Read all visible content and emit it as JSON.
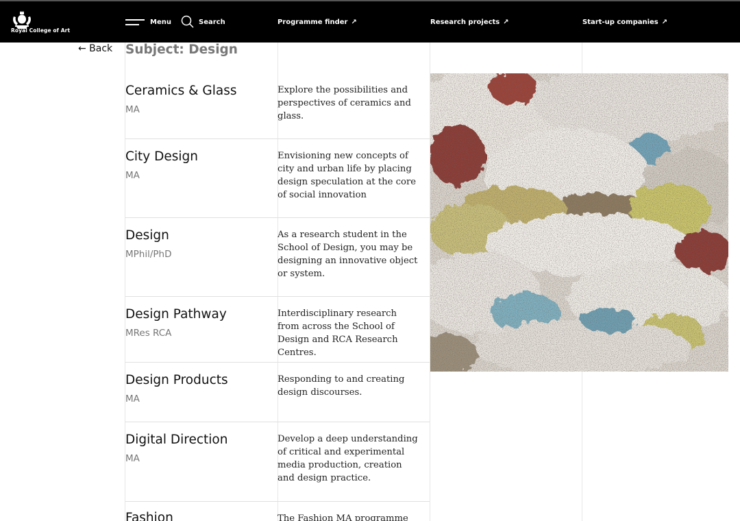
{
  "header": {
    "logo_text": "Royal College of Art",
    "menu_label": "Menu",
    "search_label": "Search",
    "links": [
      {
        "label": "Programme finder",
        "icon": "arrow-up-right-icon"
      },
      {
        "label": "Research projects",
        "icon": "arrow-up-right-icon"
      },
      {
        "label": "Start-up companies",
        "icon": "arrow-up-right-icon"
      }
    ]
  },
  "back_label": "← Back",
  "subject_heading": "Subject: Design",
  "programmes": [
    {
      "title": "Ceramics & Glass",
      "award": "MA",
      "description": "Explore the possibilities and perspectives of ceramics and glass."
    },
    {
      "title": "City Design",
      "award": "MA",
      "description": "Envisioning new concepts of city and urban life by placing design speculation at the core of social innovation"
    },
    {
      "title": "Design",
      "award": "MPhil/PhD",
      "description": "As a research student in the School of Design, you may be designing an innovative object or system."
    },
    {
      "title": "Design Pathway",
      "award": "MRes RCA",
      "description": "Interdisciplinary research from across the School of Design and RCA Research Centres."
    },
    {
      "title": "Design Products",
      "award": "MA",
      "description": "Responding to and creating design discourses."
    },
    {
      "title": "Digital Direction",
      "award": "MA",
      "description": "Develop a deep understanding of critical and experimental media production, creation and design practice."
    },
    {
      "title": "Fashion",
      "award": "",
      "description": "The Fashion MA programme"
    }
  ],
  "colors": {
    "header_bg": "#000000",
    "text_primary": "#111111",
    "text_muted": "#777777",
    "divider": "#e0e0e0"
  }
}
